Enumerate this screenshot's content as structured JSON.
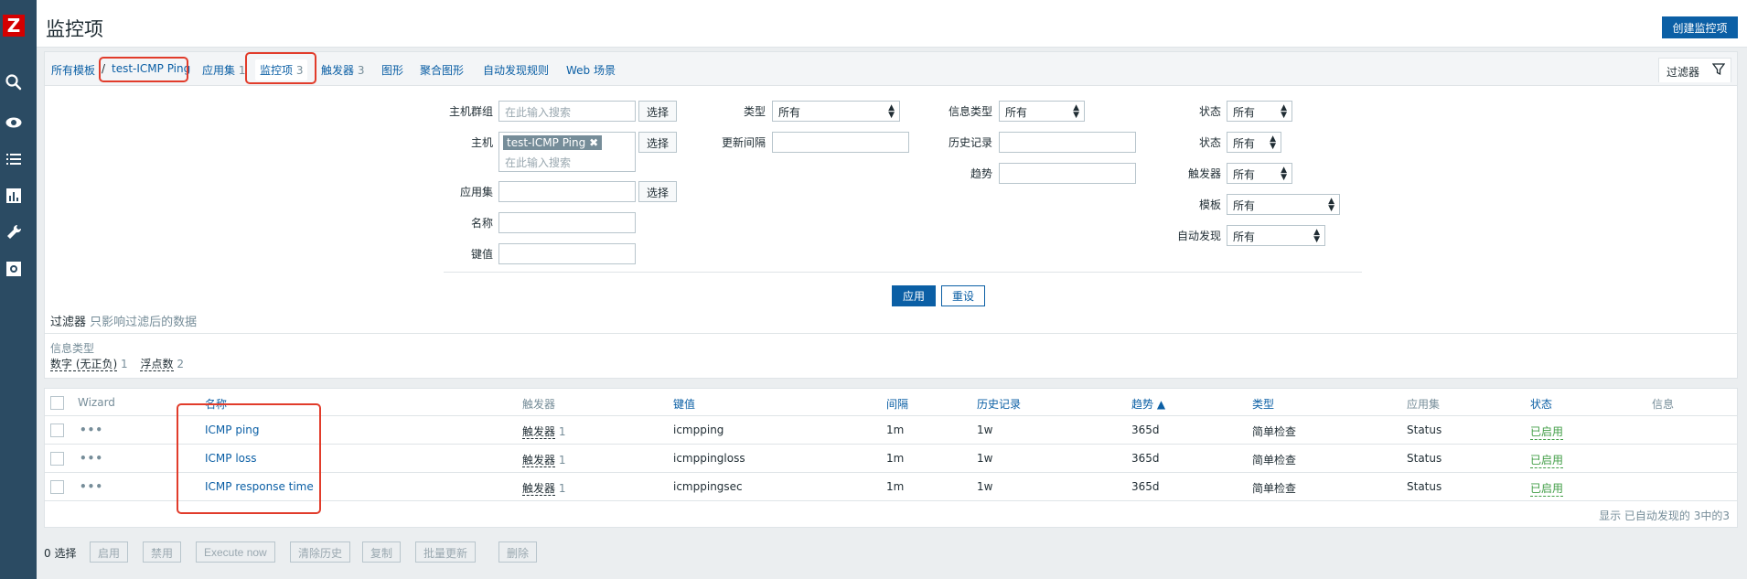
{
  "logo": "Z",
  "page_title": "监控项",
  "create_button": "创建监控项",
  "nav": {
    "all_templates": "所有模板",
    "sep": "/",
    "template": "test-ICMP Ping",
    "applications": "应用集",
    "applications_count": "1",
    "items": "监控项",
    "items_count": "3",
    "triggers": "触发器",
    "triggers_count": "3",
    "graphs": "图形",
    "screens": "聚合图形",
    "discovery": "自动发现规则",
    "web": "Web 场景",
    "filter_tab": "过滤器"
  },
  "filter": {
    "host_group_label": "主机群组",
    "host_group_placeholder": "在此输入搜索",
    "select": "选择",
    "host_label": "主机",
    "host_tag": "test-ICMP Ping",
    "host_placeholder": "在此输入搜索",
    "app_label": "应用集",
    "name_label": "名称",
    "key_label": "键值",
    "type_label": "类型",
    "type_value": "所有",
    "interval_label": "更新间隔",
    "info_type_label": "信息类型",
    "info_type_value": "所有",
    "history_label": "历史记录",
    "trends_label": "趋势",
    "status_label": "状态",
    "status_value": "所有",
    "state_label": "状态",
    "state_value": "所有",
    "triggers_label": "触发器",
    "triggers_value": "所有",
    "template_label": "模板",
    "template_value": "所有",
    "discovery_label": "自动发现",
    "discovery_value": "所有",
    "apply": "应用",
    "reset": "重设",
    "note_title": "过滤器",
    "note_text": "只影响过滤后的数据",
    "subfilter_title": "信息类型",
    "subfilter_a": "数字 (无正负)",
    "subfilter_a_count": "1",
    "subfilter_b": "浮点数",
    "subfilter_b_count": "2"
  },
  "table": {
    "headers": {
      "wizard": "Wizard",
      "name": "名称",
      "triggers": "触发器",
      "key": "键值",
      "interval": "间隔",
      "history": "历史记录",
      "trends": "趋势 ▲",
      "type": "类型",
      "applications": "应用集",
      "status": "状态",
      "info": "信息"
    },
    "rows": [
      {
        "dots": "•••",
        "name": "ICMP ping",
        "trig": "触发器",
        "trig_count": "1",
        "key": "icmpping",
        "interval": "1m",
        "history": "1w",
        "trends": "365d",
        "type": "简单检查",
        "app": "Status",
        "status": "已启用"
      },
      {
        "dots": "•••",
        "name": "ICMP loss",
        "trig": "触发器",
        "trig_count": "1",
        "key": "icmppingloss",
        "interval": "1m",
        "history": "1w",
        "trends": "365d",
        "type": "简单检查",
        "app": "Status",
        "status": "已启用"
      },
      {
        "dots": "•••",
        "name": "ICMP response time",
        "trig": "触发器",
        "trig_count": "1",
        "key": "icmppingsec",
        "interval": "1m",
        "history": "1w",
        "trends": "365d",
        "type": "简单检查",
        "app": "Status",
        "status": "已启用"
      }
    ],
    "footer": "显示 已自动发现的 3中的3"
  },
  "actions": {
    "selected": "0 选择",
    "enable": "启用",
    "disable": "禁用",
    "execute": "Execute now",
    "clear_history": "清除历史",
    "copy": "复制",
    "mass_update": "批量更新",
    "delete": "删除"
  },
  "colors": {
    "sidebar": "#2b4b63",
    "accent": "#0b5fa5",
    "logo": "#d40000",
    "enabled": "#429e47",
    "annotation": "#e13c2b"
  }
}
